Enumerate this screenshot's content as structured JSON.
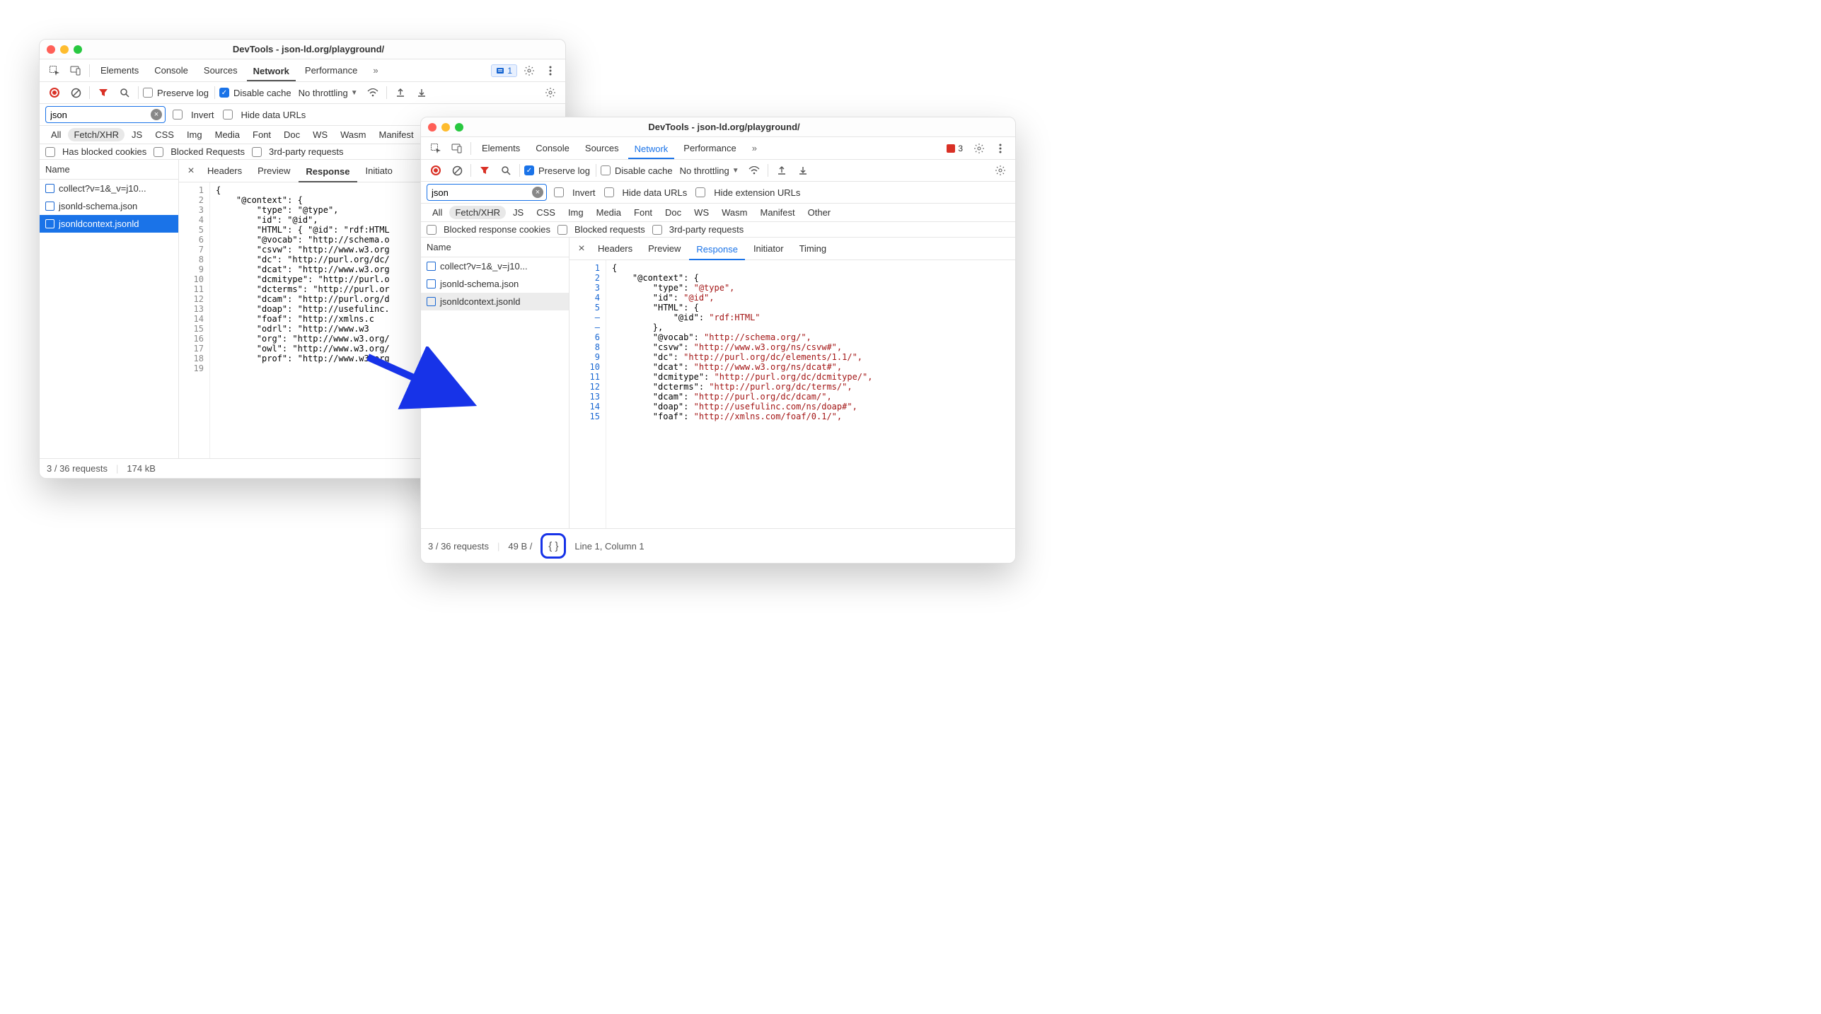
{
  "win1": {
    "title": "DevTools - json-ld.org/playground/",
    "tabs": [
      "Elements",
      "Console",
      "Sources",
      "Network",
      "Performance"
    ],
    "active_tab": "Network",
    "issues_badge": "1",
    "toolbar": {
      "preserve_log": "Preserve log",
      "preserve_checked": false,
      "disable_cache": "Disable cache",
      "disable_checked": true,
      "throttling": "No throttling"
    },
    "filter": {
      "value": "json",
      "invert": "Invert",
      "hide_data": "Hide data URLs"
    },
    "types": [
      "All",
      "Fetch/XHR",
      "JS",
      "CSS",
      "Img",
      "Media",
      "Font",
      "Doc",
      "WS",
      "Wasm",
      "Manifest"
    ],
    "active_type": "Fetch/XHR",
    "opts": {
      "blocked_cookies": "Has blocked cookies",
      "blocked_requests": "Blocked Requests",
      "third_party": "3rd-party requests"
    },
    "name_header": "Name",
    "requests": [
      "collect?v=1&_v=j10...",
      "jsonld-schema.json",
      "jsonldcontext.jsonld"
    ],
    "selected_request": 2,
    "detail_tabs": [
      "Headers",
      "Preview",
      "Response",
      "Initiato"
    ],
    "detail_active": "Response",
    "code_lines": [
      {
        "n": "1",
        "t": "{"
      },
      {
        "n": "2",
        "t": "    \"@context\": {"
      },
      {
        "n": "3",
        "t": "        \"type\": \"@type\","
      },
      {
        "n": "4",
        "t": "        \"id\": \"@id\","
      },
      {
        "n": "5",
        "t": "        \"HTML\": { \"@id\": \"rdf:HTML"
      },
      {
        "n": "6",
        "t": ""
      },
      {
        "n": "7",
        "t": "        \"@vocab\": \"http://schema.o"
      },
      {
        "n": "8",
        "t": "        \"csvw\": \"http://www.w3.org"
      },
      {
        "n": "9",
        "t": "        \"dc\": \"http://purl.org/dc/"
      },
      {
        "n": "10",
        "t": "        \"dcat\": \"http://www.w3.org"
      },
      {
        "n": "11",
        "t": "        \"dcmitype\": \"http://purl.o"
      },
      {
        "n": "12",
        "t": "        \"dcterms\": \"http://purl.or"
      },
      {
        "n": "13",
        "t": "        \"dcam\": \"http://purl.org/d"
      },
      {
        "n": "14",
        "t": "        \"doap\": \"http://usefulinc."
      },
      {
        "n": "15",
        "t": "        \"foaf\": \"http://xmlns.c"
      },
      {
        "n": "16",
        "t": "        \"odrl\": \"http://www.w3"
      },
      {
        "n": "17",
        "t": "        \"org\": \"http://www.w3.org/"
      },
      {
        "n": "18",
        "t": "        \"owl\": \"http://www.w3.org/"
      },
      {
        "n": "19",
        "t": "        \"prof\": \"http://www.w3.org"
      }
    ],
    "status": {
      "requests": "3 / 36 requests",
      "size": "174 kB"
    }
  },
  "win2": {
    "title": "DevTools - json-ld.org/playground/",
    "tabs": [
      "Elements",
      "Console",
      "Sources",
      "Network",
      "Performance"
    ],
    "active_tab": "Network",
    "errors_badge": "3",
    "toolbar": {
      "preserve_log": "Preserve log",
      "preserve_checked": true,
      "disable_cache": "Disable cache",
      "disable_checked": false,
      "throttling": "No throttling"
    },
    "filter": {
      "value": "json",
      "invert": "Invert",
      "hide_data": "Hide data URLs",
      "hide_ext": "Hide extension URLs"
    },
    "types": [
      "All",
      "Fetch/XHR",
      "JS",
      "CSS",
      "Img",
      "Media",
      "Font",
      "Doc",
      "WS",
      "Wasm",
      "Manifest",
      "Other"
    ],
    "active_type": "Fetch/XHR",
    "opts": {
      "blocked_cookies": "Blocked response cookies",
      "blocked_requests": "Blocked requests",
      "third_party": "3rd-party requests"
    },
    "name_header": "Name",
    "requests": [
      "collect?v=1&_v=j10...",
      "jsonld-schema.json",
      "jsonldcontext.jsonld"
    ],
    "hovered_request": 2,
    "detail_tabs": [
      "Headers",
      "Preview",
      "Response",
      "Initiator",
      "Timing"
    ],
    "detail_active": "Response",
    "code_lines": [
      {
        "n": "1",
        "i": 0,
        "t": "{"
      },
      {
        "n": "2",
        "i": 1,
        "k": "\"@context\"",
        "t": ": {"
      },
      {
        "n": "3",
        "i": 2,
        "k": "\"type\"",
        "v": "\"@type\","
      },
      {
        "n": "4",
        "i": 2,
        "k": "\"id\"",
        "v": "\"@id\","
      },
      {
        "n": "5",
        "i": 2,
        "k": "\"HTML\"",
        "t": ": {"
      },
      {
        "n": "–",
        "i": 3,
        "k": "\"@id\"",
        "v": "\"rdf:HTML\""
      },
      {
        "n": "–",
        "i": 2,
        "t": "},"
      },
      {
        "n": "6",
        "i": 2,
        "k": "\"@vocab\"",
        "v": "\"http://schema.org/\","
      },
      {
        "n": "8",
        "i": 2,
        "k": "\"csvw\"",
        "v": "\"http://www.w3.org/ns/csvw#\","
      },
      {
        "n": "9",
        "i": 2,
        "k": "\"dc\"",
        "v": "\"http://purl.org/dc/elements/1.1/\","
      },
      {
        "n": "10",
        "i": 2,
        "k": "\"dcat\"",
        "v": "\"http://www.w3.org/ns/dcat#\","
      },
      {
        "n": "11",
        "i": 2,
        "k": "\"dcmitype\"",
        "v": "\"http://purl.org/dc/dcmitype/\","
      },
      {
        "n": "12",
        "i": 2,
        "k": "\"dcterms\"",
        "v": "\"http://purl.org/dc/terms/\","
      },
      {
        "n": "13",
        "i": 2,
        "k": "\"dcam\"",
        "v": "\"http://purl.org/dc/dcam/\","
      },
      {
        "n": "14",
        "i": 2,
        "k": "\"doap\"",
        "v": "\"http://usefulinc.com/ns/doap#\","
      },
      {
        "n": "15",
        "i": 2,
        "k": "\"foaf\"",
        "v": "\"http://xmlns.com/foaf/0.1/\","
      }
    ],
    "status": {
      "requests": "3 / 36 requests",
      "size": "49 B /",
      "cursor": "Line 1, Column 1"
    }
  }
}
